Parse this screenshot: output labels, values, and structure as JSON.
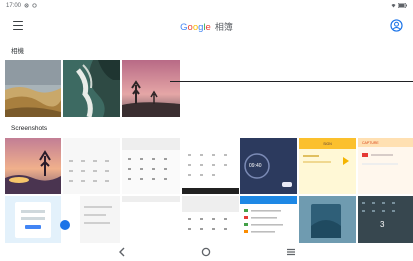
{
  "status_bar": {
    "time": "17:00"
  },
  "app_bar": {
    "brand_letters": [
      "G",
      "o",
      "o",
      "g",
      "l",
      "e"
    ],
    "product": "相簿"
  },
  "sections": {
    "camera_title": "相機",
    "screenshots_title": "Screenshots"
  },
  "screenshot_tiles": {
    "clock_time": "09:40",
    "yellow_app_header": "SIGN",
    "red_app_header": "CAPTURE",
    "calc_result": "3"
  },
  "colors": {
    "accent": "#1a73e8",
    "brand_blue": "#4285f4",
    "brand_red": "#ea4335",
    "brand_yellow": "#fbbc05",
    "brand_green": "#34a853"
  },
  "icons": {
    "menu": "hamburger-menu-icon",
    "account": "account-circle-icon",
    "back": "back-triangle-icon",
    "home": "home-circle-icon",
    "recents": "recents-lines-icon"
  }
}
